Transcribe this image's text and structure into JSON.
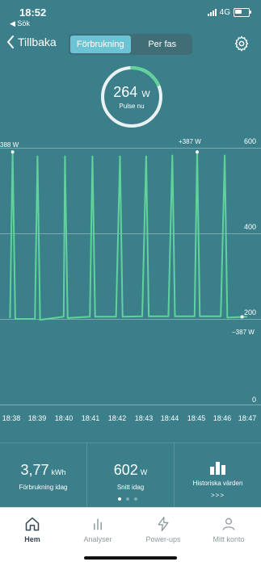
{
  "status": {
    "time": "18:52",
    "back_app": "◀ Sök",
    "network": "4G"
  },
  "nav": {
    "back_label": "Tillbaka",
    "tabs": [
      {
        "label": "Förbrukning",
        "active": true
      },
      {
        "label": "Per fas",
        "active": false
      }
    ]
  },
  "gauge": {
    "value": "264",
    "unit": "W",
    "label": "Pulse nu",
    "fill_fraction": 0.18
  },
  "chart_data": {
    "type": "line",
    "title": "",
    "xlabel": "",
    "ylabel": "",
    "x": [
      "18:38",
      "18:39",
      "18:40",
      "18:41",
      "18:42",
      "18:43",
      "18:44",
      "18:45",
      "18:46",
      "18:47"
    ],
    "y_ticks": [
      "600",
      "400",
      "200",
      "0"
    ],
    "ylim": [
      0,
      600
    ],
    "series": [
      {
        "color": "#5fd39a",
        "points": [
          [
            "18:37.95",
            202
          ],
          [
            "18:38.05",
            590
          ],
          [
            "18:38.15",
            200
          ],
          [
            "18:38.9",
            200
          ],
          [
            "18:39.0",
            580
          ],
          [
            "18:39.1",
            198
          ],
          [
            "18:40.0",
            205
          ],
          [
            "18:40.05",
            580
          ],
          [
            "18:40.15",
            202
          ],
          [
            "18:41.0",
            205
          ],
          [
            "18:41.1",
            580
          ],
          [
            "18:41.2",
            205
          ],
          [
            "18:42.0",
            205
          ],
          [
            "18:42.15",
            580
          ],
          [
            "18:42.25",
            205
          ],
          [
            "18:43.0",
            206
          ],
          [
            "18:43.15",
            580
          ],
          [
            "18:43.25",
            206
          ],
          [
            "18:44.0",
            206
          ],
          [
            "18:44.15",
            582
          ],
          [
            "18:44.25",
            206
          ],
          [
            "18:45.0",
            206
          ],
          [
            "18:45.1",
            590
          ],
          [
            "18:45.2",
            206
          ],
          [
            "18:46.0",
            206
          ],
          [
            "18:46.15",
            582
          ],
          [
            "18:46.25",
            203
          ],
          [
            "18:47.0",
            205
          ]
        ]
      }
    ],
    "annotations": [
      {
        "label": "388 W"
      },
      {
        "label": "+387 W"
      },
      {
        "label": "−387 W"
      }
    ],
    "grid": true
  },
  "stats": [
    {
      "value": "3,77",
      "unit": "kWh",
      "label": "Förbrukning idag"
    },
    {
      "value": "602",
      "unit": "W",
      "label": "Snitt idag"
    },
    {
      "label": "Historiska värden",
      "arrows": ">>>"
    }
  ],
  "tabs": [
    {
      "label": "Hem",
      "icon": "home-icon",
      "active": true
    },
    {
      "label": "Analyser",
      "icon": "bar-chart-icon",
      "active": false
    },
    {
      "label": "Power-ups",
      "icon": "bolt-icon",
      "active": false
    },
    {
      "label": "Mitt konto",
      "icon": "person-icon",
      "active": false
    }
  ],
  "colors": {
    "background": "#3a7f8a",
    "accent": "#5fd39a",
    "segment_active": "#6cc3d3",
    "tabbar": "#ffffff"
  }
}
